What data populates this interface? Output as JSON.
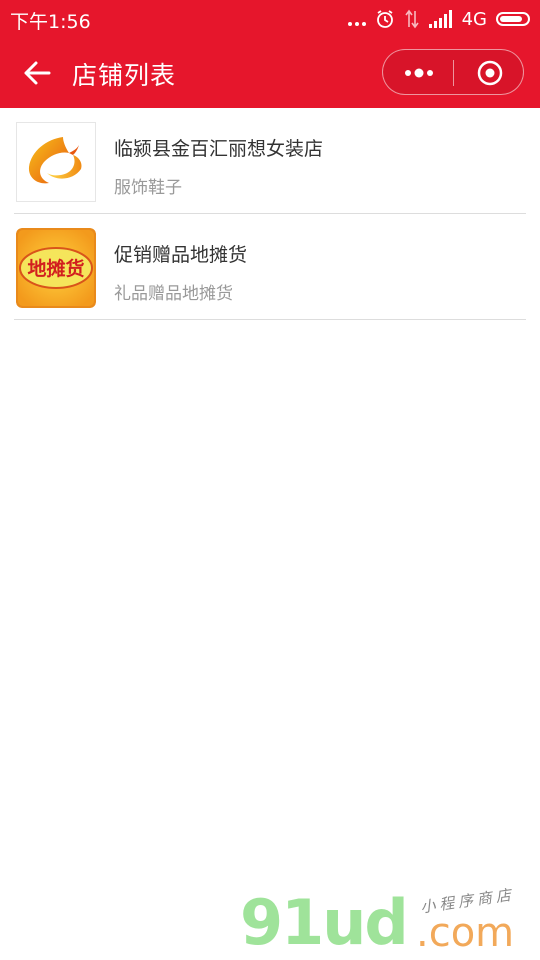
{
  "status_bar": {
    "time": "下午1:56",
    "network": "4G"
  },
  "nav": {
    "title": "店铺列表"
  },
  "stores": [
    {
      "name": "临颍县金百汇丽想女装店",
      "category": "服饰鞋子",
      "logo_icon": "phoenix-logo-icon"
    },
    {
      "name": "促销赠品地摊货",
      "category": "礼品赠品地摊货",
      "logo_text": "地摊货"
    }
  ],
  "watermark": {
    "logo": "91ud",
    "domain": ".com",
    "tagline": "小程序商店"
  },
  "colors": {
    "brand_red": "#e6162c",
    "text_primary": "#333333",
    "text_secondary": "#999999",
    "divider": "#dddddd"
  }
}
